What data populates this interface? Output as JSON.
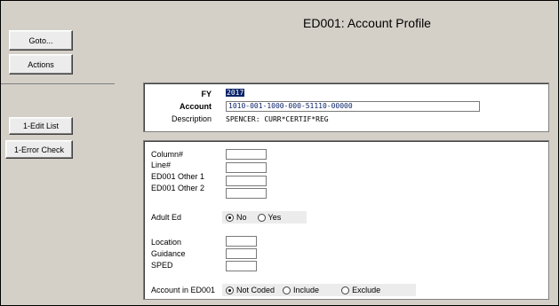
{
  "title": "ED001: Account Profile",
  "sidebar": {
    "goto": "Goto...",
    "actions": "Actions",
    "edit_list": "1-Edit List",
    "error_check": "1-Error Check"
  },
  "header_panel": {
    "fy_label": "FY",
    "fy_value": "2017",
    "account_label": "Account",
    "account_value": "1010-001-1000-000-51110-00000",
    "description_label": "Description",
    "description_value": "SPENCER: CURR*CERTIF*REG"
  },
  "detail_panel": {
    "column_label": "Column#",
    "line_label": "Line#",
    "other1_label": "ED001 Other 1",
    "other2_label": "ED001 Other 2",
    "adult_ed_label": "Adult Ed",
    "adult_ed_options": [
      "No",
      "Yes"
    ],
    "adult_ed_selected": "No",
    "location_label": "Location",
    "guidance_label": "Guidance",
    "sped_label": "SPED",
    "account_in_label": "Account in ED001",
    "account_in_options": [
      "Not Coded",
      "Include",
      "Exclude"
    ],
    "account_in_selected": "Not Coded"
  }
}
